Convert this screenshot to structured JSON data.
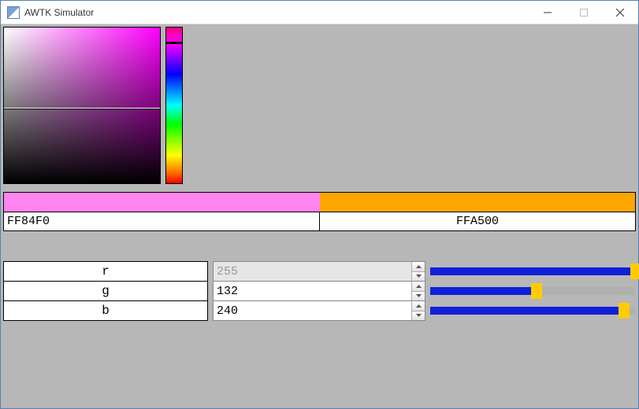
{
  "window": {
    "title": "AWTK Simulator"
  },
  "swatches": {
    "left_color": "#ff84f0",
    "right_color": "#ffa500",
    "left_hex": "FF84F0",
    "right_hex": "FFA500"
  },
  "rgb": {
    "r": {
      "label": "r",
      "value": "255",
      "slider": 255,
      "disabled": true
    },
    "g": {
      "label": "g",
      "value": "132",
      "slider": 132,
      "disabled": false
    },
    "b": {
      "label": "b",
      "value": "240",
      "slider": 240,
      "disabled": false
    }
  },
  "slider_max": 255
}
